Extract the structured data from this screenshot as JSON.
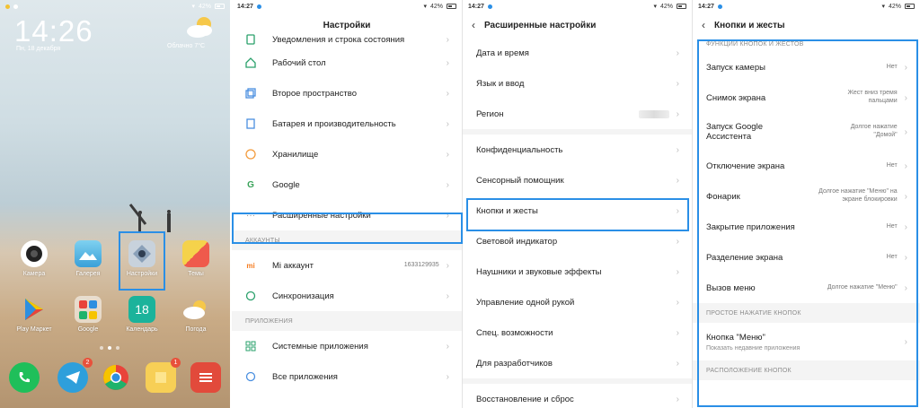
{
  "panel1": {
    "status": {
      "time": "",
      "battery": "42%"
    },
    "clock": "14:26",
    "date": "Пн, 18 декабря",
    "weather": "Облачно  7°C",
    "apps_row1": [
      "Камера",
      "Галерея",
      "Настройки",
      "Темы"
    ],
    "apps_row2": [
      "Play Маркет",
      "Google",
      "Календарь",
      "Погода"
    ],
    "calendar_day": "18",
    "telegram_badge": "2",
    "notes_badge": "1"
  },
  "panel2": {
    "status": {
      "time": "14:27",
      "battery": "42%"
    },
    "title": "Настройки",
    "items": [
      "Уведомления и строка состояния",
      "Рабочий стол",
      "Второе пространство",
      "Батарея и производительность",
      "Хранилище",
      "Google",
      "Расширенные настройки"
    ],
    "accounts_header": "АККАУНТЫ",
    "account_items": [
      "Mi аккаунт",
      "Синхронизация"
    ],
    "mi_account_id": "1633129935",
    "apps_header": "ПРИЛОЖЕНИЯ",
    "app_items": [
      "Системные приложения",
      "Все приложения"
    ]
  },
  "panel3": {
    "status": {
      "time": "14:27",
      "battery": "42%"
    },
    "title": "Расширенные настройки",
    "group1": [
      "Дата и время",
      "Язык и ввод",
      "Регион"
    ],
    "group2": [
      "Конфиденциальность",
      "Сенсорный помощник",
      "Кнопки и жесты",
      "Световой индикатор",
      "Наушники и звуковые эффекты",
      "Управление одной рукой",
      "Спец. возможности",
      "Для разработчиков"
    ],
    "group3": [
      "Восстановление и сброс"
    ]
  },
  "panel4": {
    "status": {
      "time": "14:27",
      "battery": "42%"
    },
    "title": "Кнопки и жесты",
    "section1": "ФУНКЦИИ КНОПОК И ЖЕСТОВ",
    "items": [
      {
        "label": "Запуск камеры",
        "value": "Нет"
      },
      {
        "label": "Снимок экрана",
        "value": "Жест вниз тремя пальцами"
      },
      {
        "label": "Запуск Google Ассистента",
        "value": "Долгое нажатие \"Домой\""
      },
      {
        "label": "Отключение экрана",
        "value": "Нет"
      },
      {
        "label": "Фонарик",
        "value": "Долгое нажатие \"Меню\" на экране блокировки"
      },
      {
        "label": "Закрытие приложения",
        "value": "Нет"
      },
      {
        "label": "Разделение экрана",
        "value": "Нет"
      },
      {
        "label": "Вызов меню",
        "value": "Долгое нажатие \"Меню\""
      }
    ],
    "section2": "ПРОСТОЕ НАЖАТИЕ КНОПОК",
    "menu_button": {
      "label": "Кнопка \"Меню\"",
      "sub": "Показать недавние приложения"
    },
    "section3": "РАСПОЛОЖЕНИЕ КНОПОК"
  },
  "colors": {
    "highlight": "#2a8fe6",
    "chevron": "#bdbdbd",
    "section_bg": "#f4f4f4"
  }
}
